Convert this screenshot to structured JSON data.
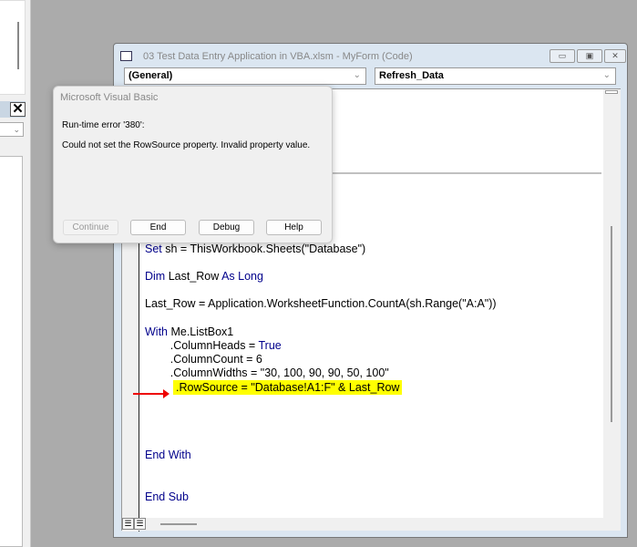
{
  "window": {
    "title": "03 Test Data Entry Application in VBA.xlsm - MyForm (Code)",
    "object_combo": "(General)",
    "procedure_combo": "Refresh_Data"
  },
  "left_panel": {
    "close_glyph": "✕"
  },
  "code": {
    "line_set": [
      {
        "t": "Set",
        "kw": true
      },
      {
        "t": " sh = ThisWorkbook.Sheets(\"Database\")"
      }
    ],
    "line_dim": [
      {
        "t": "Dim",
        "kw": true
      },
      {
        "t": " Last_Row "
      },
      {
        "t": "As Long",
        "kw": true
      }
    ],
    "line_lastrow": [
      {
        "t": "Last_Row = Application.WorksheetFunction.CountA(sh.Range(\"A:A\"))"
      }
    ],
    "line_with": [
      {
        "t": "With",
        "kw": true
      },
      {
        "t": " Me.ListBox1"
      }
    ],
    "line_heads": [
      {
        "t": "        .ColumnHeads = "
      },
      {
        "t": "True",
        "kw": true
      }
    ],
    "line_count": [
      {
        "t": "        .ColumnCount = 6"
      }
    ],
    "line_widths": [
      {
        "t": "        .ColumnWidths = \"30, 100, 90, 90, 50, 100\""
      }
    ],
    "line_rowsource": ".RowSource = \"Database!A1:F\" & Last_Row",
    "line_endwith": "End With",
    "line_endsub": "End Sub"
  },
  "dialog": {
    "title": "Microsoft Visual Basic",
    "error": "Run-time error '380':",
    "message": "Could not set the RowSource property. Invalid property value.",
    "buttons": {
      "continue": "Continue",
      "end": "End",
      "debug": "Debug",
      "help": "Help"
    }
  },
  "colors": {
    "keyword": "#00008b",
    "highlight": "#ffff00",
    "arrow": "#e00000"
  }
}
